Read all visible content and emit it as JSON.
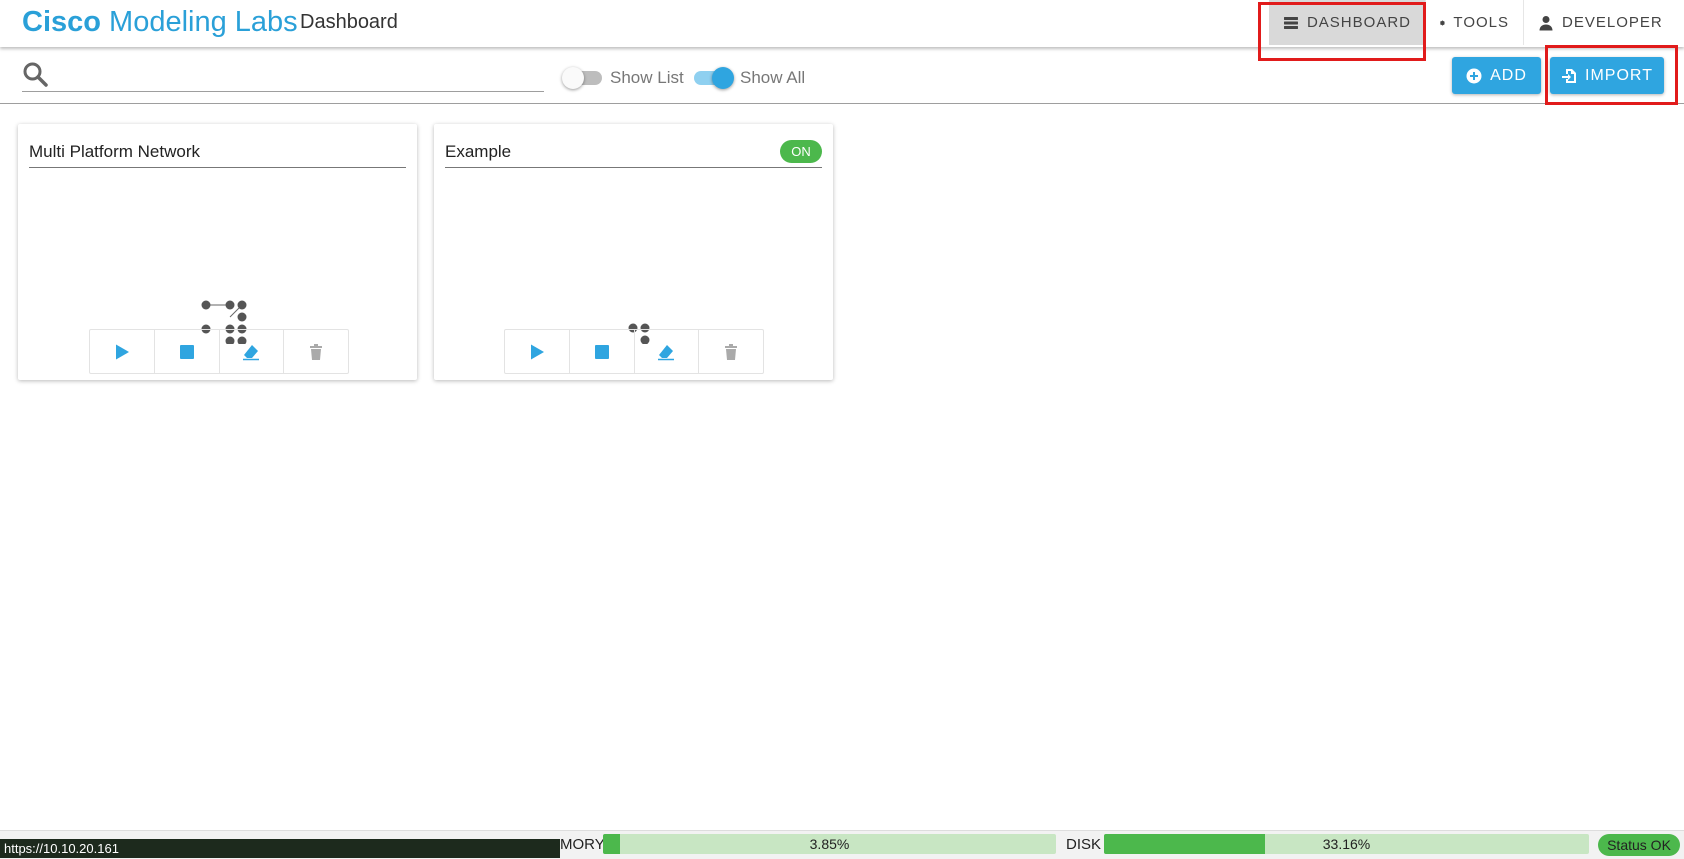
{
  "header": {
    "brand_bold": "Cisco",
    "brand_rest": " Modeling Labs",
    "page_title": "Dashboard",
    "nav": [
      {
        "label": "DASHBOARD",
        "icon": "dashboard-list-icon",
        "active": true
      },
      {
        "label": "TOOLS",
        "icon": "gear-icon",
        "active": false
      },
      {
        "label": "DEVELOPER",
        "icon": "user-icon",
        "active": false
      }
    ]
  },
  "toolbar": {
    "search_value": "",
    "show_list_label": "Show List",
    "show_list_on": false,
    "show_all_label": "Show All",
    "show_all_on": true,
    "add_label": "ADD",
    "import_label": "IMPORT"
  },
  "labs": [
    {
      "title": "Multi Platform Network",
      "state_badge": ""
    },
    {
      "title": "Example",
      "state_badge": "ON"
    }
  ],
  "statusbar": {
    "url_tooltip": "https://10.10.20.161",
    "memory_label": "MORY",
    "memory_value": "3.85%",
    "memory_fraction": 0.0385,
    "disk_label": "DISK",
    "disk_value": "33.16%",
    "disk_fraction": 0.3316,
    "status": "Status OK"
  },
  "colors": {
    "accent": "#2fa5e0",
    "brand": "#2aa0d8",
    "success": "#4cb84c",
    "highlight": "#e11b1b"
  }
}
